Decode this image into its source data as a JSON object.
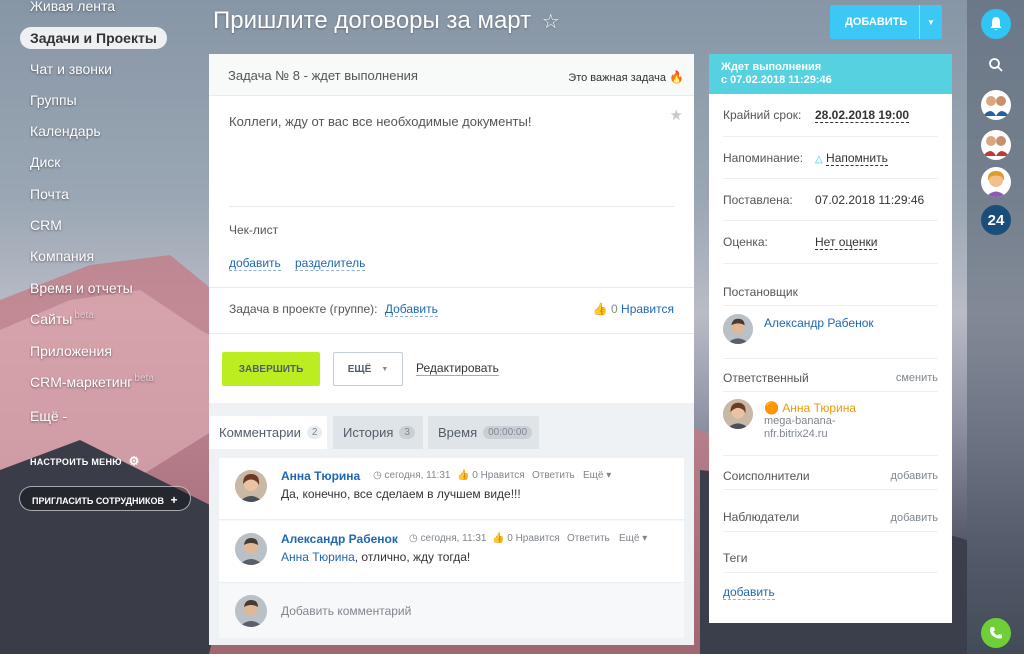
{
  "menu": {
    "items": [
      {
        "label": "Живая лента"
      },
      {
        "label": "Задачи и Проекты"
      },
      {
        "label": "Чат и звонки"
      },
      {
        "label": "Группы"
      },
      {
        "label": "Календарь"
      },
      {
        "label": "Диск"
      },
      {
        "label": "Почта"
      },
      {
        "label": "CRM"
      },
      {
        "label": "Компания"
      },
      {
        "label": "Время и отчеты"
      },
      {
        "label": "Сайты",
        "badge": "beta"
      },
      {
        "label": "Приложения"
      },
      {
        "label": "CRM-маркетинг",
        "badge": "beta"
      },
      {
        "label": "Ещё -"
      }
    ],
    "settings": "НАСТРОИТЬ МЕНЮ",
    "invite": "ПРИГЛАСИТЬ СОТРУДНИКОВ"
  },
  "header": {
    "title": "Пришлите договоры за март",
    "star": "☆",
    "add_button": "ДОБАВИТЬ"
  },
  "task": {
    "head": "Задача № 8 - ждет выполнения",
    "important": "Это важная задача",
    "description": "Коллеги, жду от вас все необходимые документы!",
    "checklist_label": "Чек-лист",
    "checklist_add": "добавить",
    "checklist_separator": "разделитель",
    "project_label": "Задача в проекте (группе):",
    "project_add": "Добавить",
    "likes_count": "0",
    "likes_label": "Нравится",
    "finish_button": "ЗАВЕРШИТЬ",
    "more_button": "ЕЩЁ",
    "edit_link": "Редактировать"
  },
  "tabs": [
    {
      "label": "Комментарии",
      "count": "2"
    },
    {
      "label": "История",
      "count": "3"
    },
    {
      "label": "Время",
      "count": "00:00:00"
    }
  ],
  "comments": [
    {
      "author": "Анна Тюрина",
      "time": "сегодня, 11:31",
      "likes": "0 Нравится",
      "reply": "Ответить",
      "more": "Ещё",
      "text": "Да, конечно, все сделаем в лучшем виде!!!",
      "mention": ""
    },
    {
      "author": "Александр Рабенок",
      "time": "сегодня, 11:31",
      "likes": "0 Нравится",
      "reply": "Ответить",
      "more": "Ещё",
      "text": ", отлично, жду тогда!",
      "mention": "Анна Тюрина"
    }
  ],
  "add_comment": "Добавить комментарий",
  "panel": {
    "status_line1": "Ждет выполнения",
    "status_line2": "с 07.02.2018 11:29:46",
    "deadline_label": "Крайний срок:",
    "deadline_value": "28.02.2018 19:00",
    "reminder_label": "Напоминание:",
    "reminder_value": "Напомнить",
    "created_label": "Поставлена:",
    "created_value": "07.02.2018 11:29:46",
    "rating_label": "Оценка:",
    "rating_value": "Нет оценки",
    "creator_label": "Постановщик",
    "creator_name": "Александр Рабенок",
    "responsible_label": "Ответственный",
    "responsible_change": "сменить",
    "responsible_name": "Анна Тюрина",
    "responsible_sub1": "mega-banana-",
    "responsible_sub2": "nfr.bitrix24.ru",
    "accomplices_label": "Соисполнители",
    "accomplices_add": "добавить",
    "observers_label": "Наблюдатели",
    "observers_add": "добавить",
    "tags_label": "Теги",
    "tags_add": "добавить"
  },
  "rightbar": {
    "logo": "24"
  }
}
